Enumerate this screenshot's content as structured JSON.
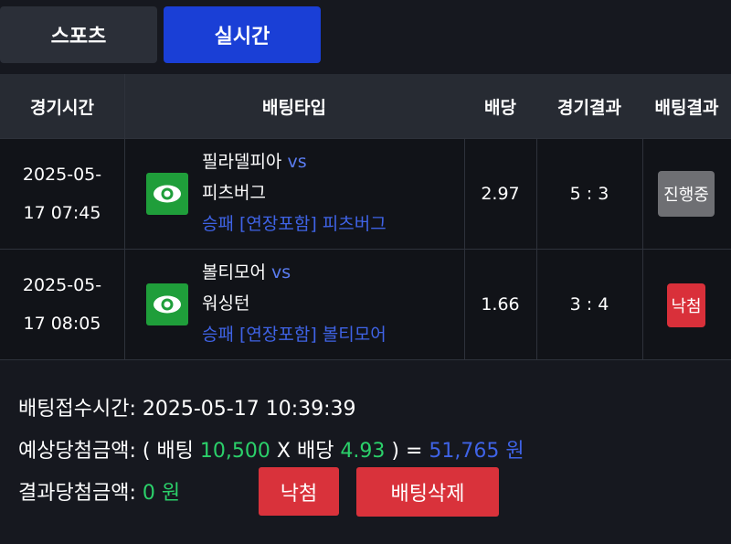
{
  "tabs": {
    "sports": "스포츠",
    "live": "실시간"
  },
  "headers": {
    "time": "경기시간",
    "bet_type": "배팅타입",
    "odds": "배당",
    "game_result": "경기결과",
    "bet_result": "배팅결과"
  },
  "rows": [
    {
      "date": "2025-05-",
      "time": "17 07:45",
      "home": "필라델피아",
      "vs": "vs",
      "away": "피츠버그",
      "bet": "승패 [연장포함] 피츠버그",
      "odds": "2.97",
      "score": "5 : 3",
      "status": "진행중",
      "status_color": "#6e6f73"
    },
    {
      "date": "2025-05-",
      "time": "17 08:05",
      "home": "볼티모어",
      "vs": "vs",
      "away": "워싱턴",
      "bet": "승패 [연장포함] 볼티모어",
      "odds": "1.66",
      "score": "3 : 4",
      "status": "낙첨",
      "status_color": "#d9303a"
    }
  ],
  "summary": {
    "accept_label": "배팅접수시간: ",
    "accept_time": "2025-05-17 10:39:39",
    "expected_label": "예상당첨금액: ( 배팅 ",
    "stake": "10,500",
    "x_odds_label": " X 배당 ",
    "total_odds": "4.93",
    "eq_label": " ) = ",
    "expected_amount": "51,765 원",
    "result_label": "결과당첨금액: ",
    "result_amount": "0 원"
  },
  "buttons": {
    "result": "낙첨",
    "delete": "배팅삭제"
  },
  "colors": {
    "accent_blue": "#1a3fd6",
    "green": "#2bd06a",
    "red": "#d9323b"
  }
}
